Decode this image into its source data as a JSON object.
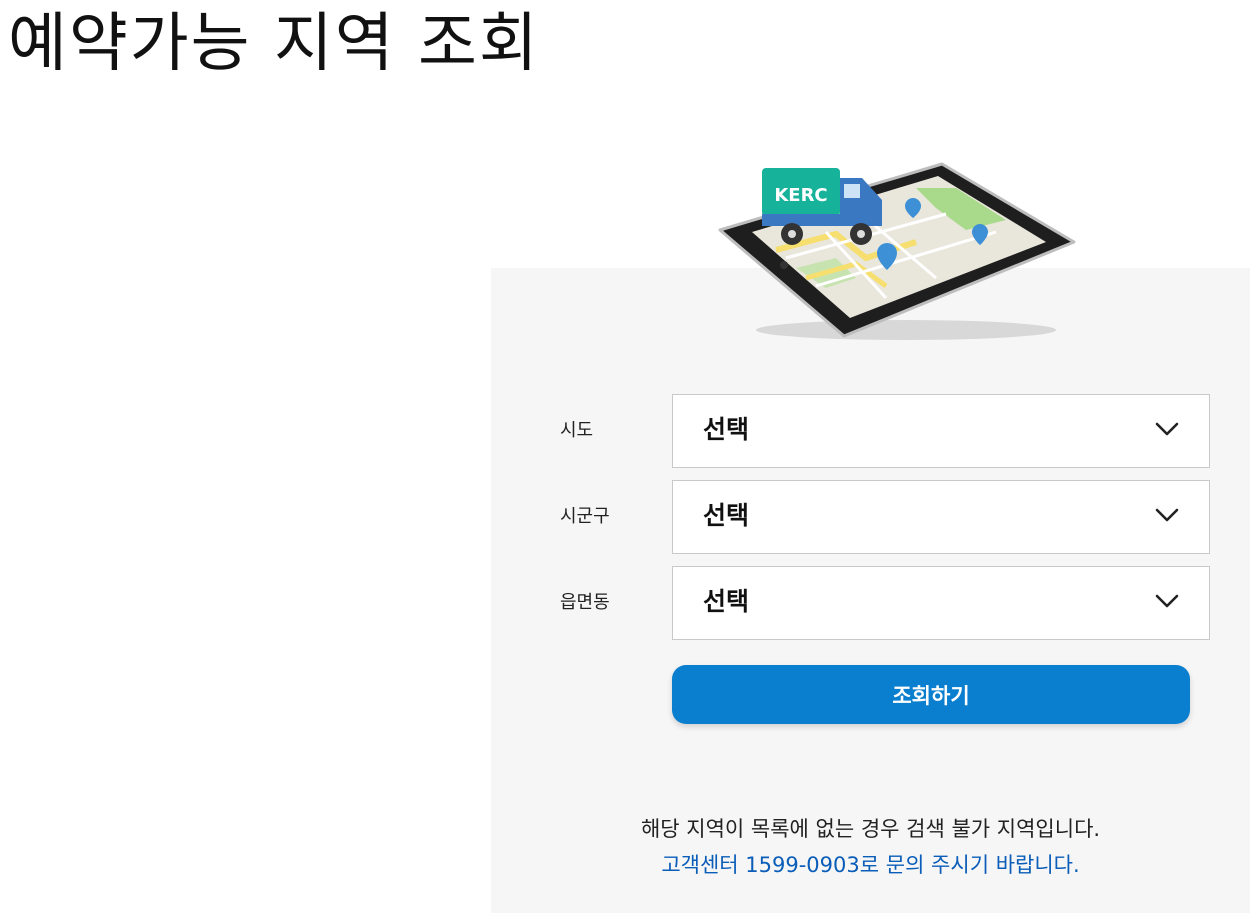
{
  "title": "예약가능 지역 조회",
  "illustration": {
    "truck_label": "KERC"
  },
  "form": {
    "fields": [
      {
        "label": "시도",
        "value": "선택"
      },
      {
        "label": "시군구",
        "value": "선택"
      },
      {
        "label": "읍면동",
        "value": "선택"
      }
    ],
    "submit_label": "조회하기"
  },
  "notice": {
    "line1": "해당 지역이 목록에 없는 경우 검색 불가 지역입니다.",
    "line2": "고객센터 1599-0903로 문의 주시기 바랍니다."
  },
  "colors": {
    "accent": "#0a7ecf",
    "link": "#0a5db8",
    "panel_bg": "#f6f6f6",
    "truck_cab": "#3a78c2",
    "truck_box": "#16b39a"
  }
}
